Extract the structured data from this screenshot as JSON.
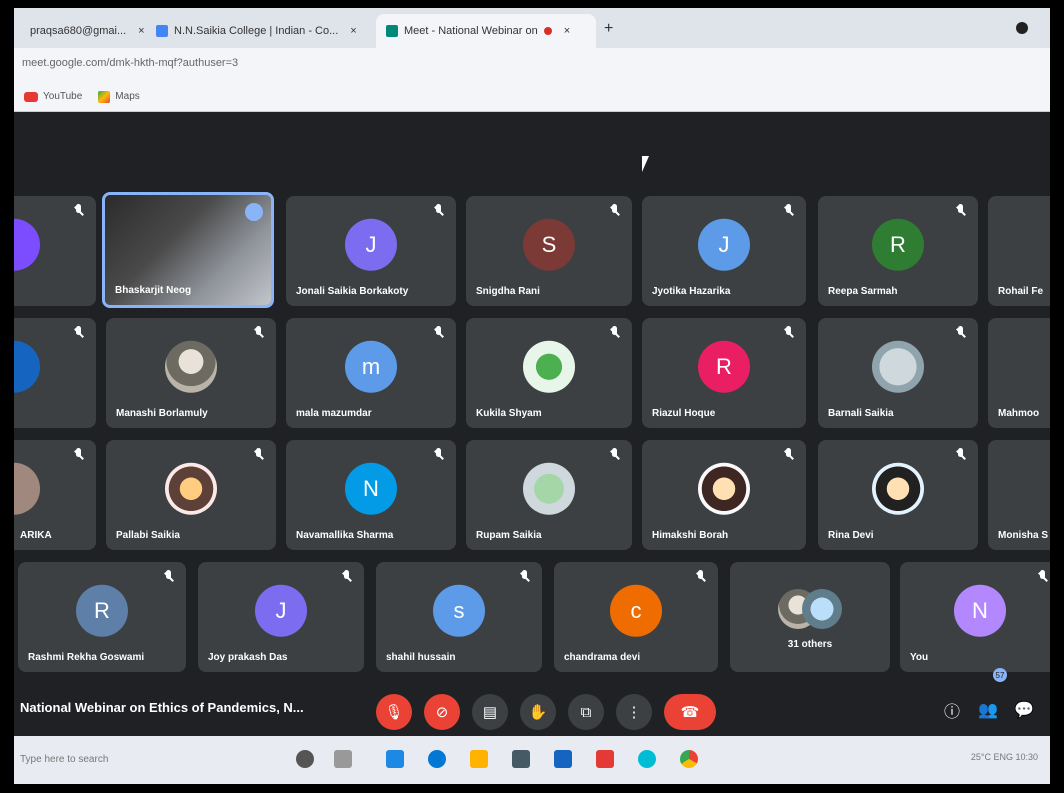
{
  "browser": {
    "tabs": [
      {
        "label": "praqsa680@gmai...",
        "favicon_color": "#d93025"
      },
      {
        "label": "N.N.Saikia College | Indian - Co...",
        "favicon_color": "#4285f4"
      },
      {
        "label": "Meet - National Webinar on",
        "favicon_color": "#00897b"
      }
    ],
    "url": "meet.google.com/dmk-hkth-mqf?authuser=3",
    "bookmarks": [
      {
        "label": "YouTube",
        "icon": "youtube-icon"
      },
      {
        "label": "Maps",
        "icon": "maps-icon"
      }
    ]
  },
  "participants": [
    {
      "name": "",
      "initial": "",
      "color": "#7c4dff",
      "row": 0
    },
    {
      "name": "Bhaskarjit Neog",
      "initial": "",
      "color": "",
      "row": 0,
      "speaking": true
    },
    {
      "name": "Jonali Saikia Borkakoty",
      "initial": "J",
      "color": "#7c6cf0",
      "row": 0
    },
    {
      "name": "Snigdha Rani",
      "initial": "S",
      "color": "#7b3a36",
      "row": 0
    },
    {
      "name": "Jyotika Hazarika",
      "initial": "J",
      "color": "#5d9be8",
      "row": 0
    },
    {
      "name": "Reepa Sarmah",
      "initial": "R",
      "color": "#2e7d32",
      "row": 0
    },
    {
      "name": "Rohail Fe",
      "initial": "",
      "color": "",
      "row": 0
    },
    {
      "name": "",
      "initial": "",
      "color": "#1565c0",
      "row": 1
    },
    {
      "name": "Manashi Borlamuly",
      "initial": "",
      "color": "",
      "row": 1
    },
    {
      "name": "mala mazumdar",
      "initial": "m",
      "color": "#5d9be8",
      "row": 1
    },
    {
      "name": "Kukila Shyam",
      "initial": "",
      "color": "",
      "row": 1
    },
    {
      "name": "Riazul Hoque",
      "initial": "R",
      "color": "#e91e63",
      "row": 1
    },
    {
      "name": "Barnali Saikia",
      "initial": "",
      "color": "",
      "row": 1
    },
    {
      "name": "Mahmoo",
      "initial": "",
      "color": "",
      "row": 1
    },
    {
      "name": "ARIKA",
      "initial": "",
      "color": "#a1887f",
      "row": 2
    },
    {
      "name": "Pallabi Saikia",
      "initial": "",
      "color": "",
      "row": 2
    },
    {
      "name": "Navamallika Sharma",
      "initial": "N",
      "color": "#039be5",
      "row": 2
    },
    {
      "name": "Rupam Saikia",
      "initial": "",
      "color": "",
      "row": 2
    },
    {
      "name": "Himakshi Borah",
      "initial": "",
      "color": "",
      "row": 2
    },
    {
      "name": "Rina Devi",
      "initial": "",
      "color": "",
      "row": 2
    },
    {
      "name": "Monisha S",
      "initial": "",
      "color": "#ab47bc",
      "row": 2
    },
    {
      "name": "Rashmi Rekha Goswami",
      "initial": "R",
      "color": "#5d7fa8",
      "row": 3
    },
    {
      "name": "Joy prakash Das",
      "initial": "J",
      "color": "#7c6cf0",
      "row": 3
    },
    {
      "name": "shahil hussain",
      "initial": "s",
      "color": "#5d9be8",
      "row": 3
    },
    {
      "name": "chandrama devi",
      "initial": "c",
      "color": "#ef6c00",
      "row": 3
    },
    {
      "name": "31 others",
      "initial": "",
      "color": "",
      "row": 3
    },
    {
      "name": "You",
      "initial": "N",
      "color": "#b388ff",
      "row": 3
    }
  ],
  "meeting": {
    "title": "National Webinar on Ethics of Pandemics, N..."
  },
  "controls": {
    "mic": "mic-off-icon",
    "camera": "camera-off-icon",
    "captions": "captions-icon",
    "raise_hand": "hand-icon",
    "present": "present-icon",
    "more": "more-icon",
    "leave": "hangup-icon"
  },
  "side": {
    "participant_count": "57"
  },
  "taskbar": {
    "search_placeholder": "Type here to search",
    "tray_text": "25°C  ENG 10:30"
  }
}
